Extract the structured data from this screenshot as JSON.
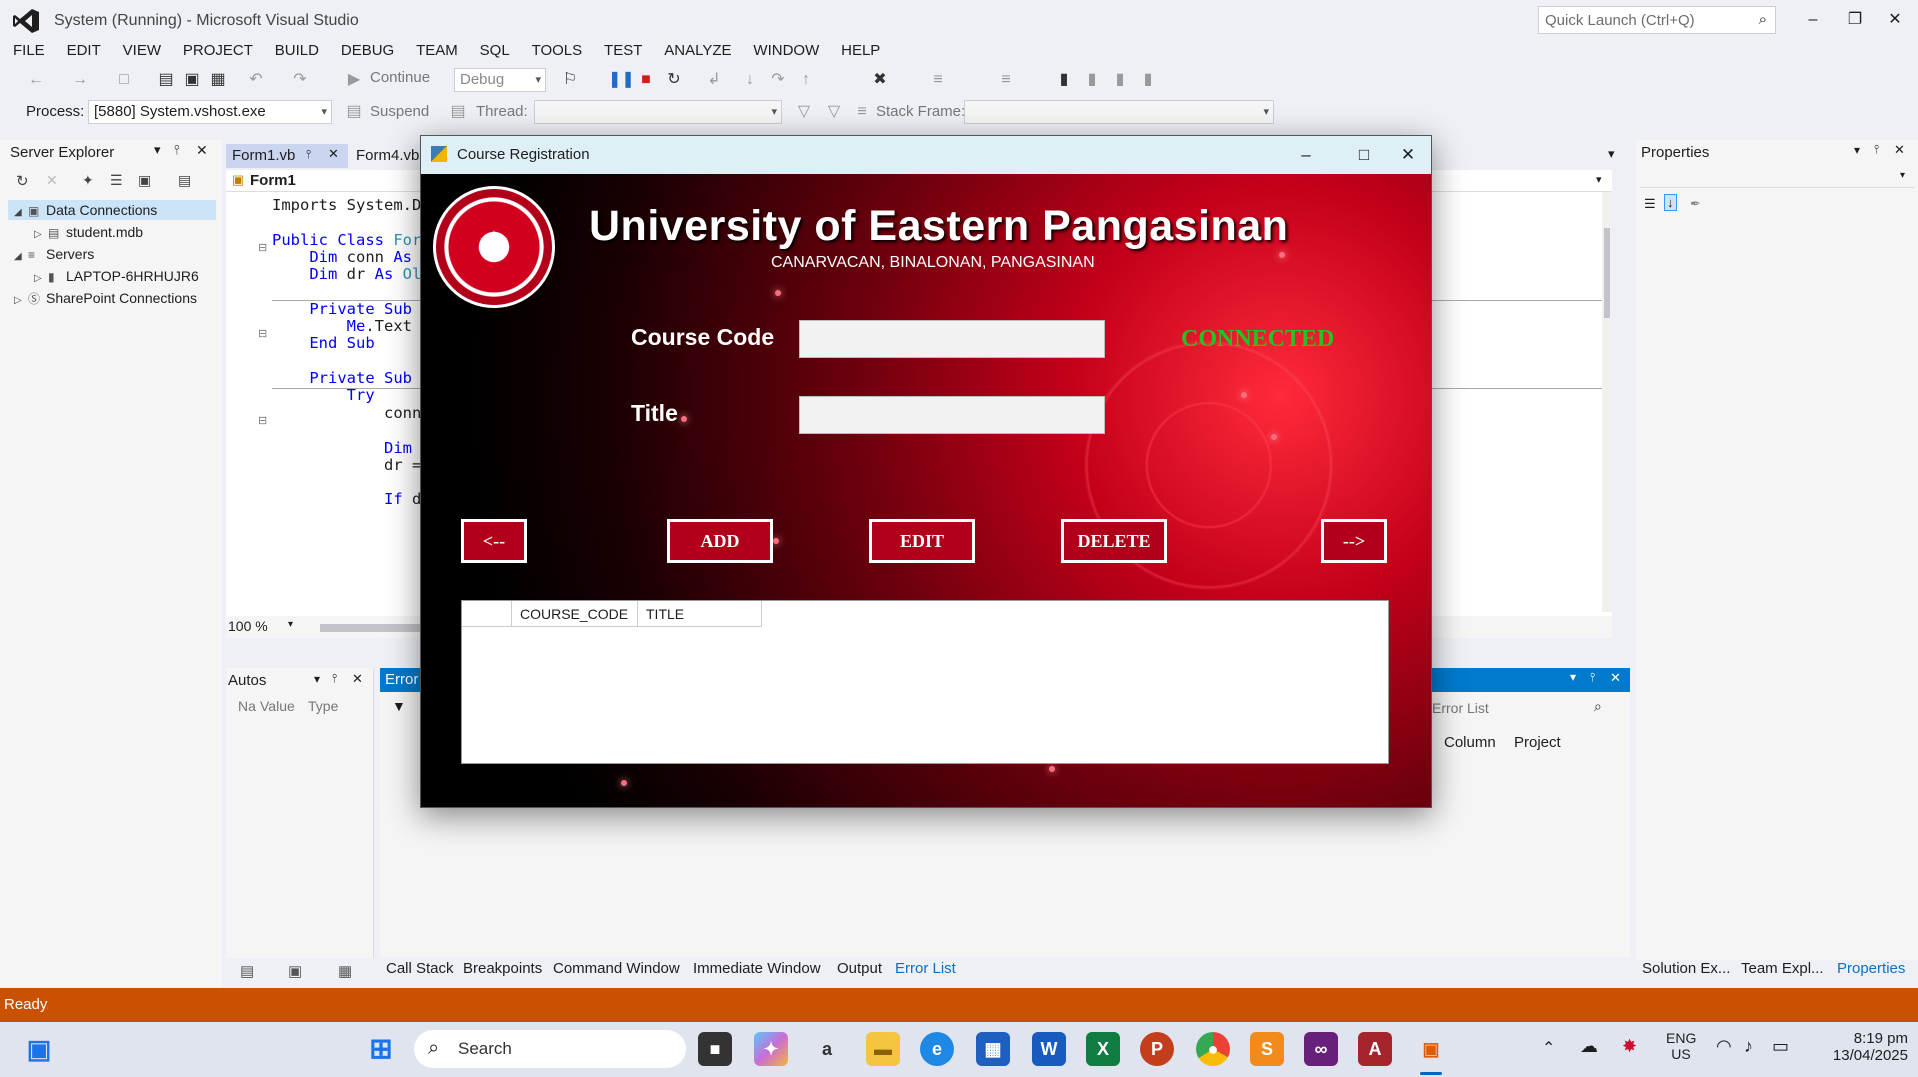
{
  "vs": {
    "title": "System (Running) - Microsoft Visual Studio",
    "quick_launch_placeholder": "Quick Launch (Ctrl+Q)",
    "menu": [
      "FILE",
      "EDIT",
      "VIEW",
      "PROJECT",
      "BUILD",
      "DEBUG",
      "TEAM",
      "SQL",
      "TOOLS",
      "TEST",
      "ANALYZE",
      "WINDOW",
      "HELP"
    ],
    "toolbar": {
      "continue_label": "Continue",
      "config_value": "Debug",
      "process_label": "Process:",
      "process_value": "[5880] System.vshost.exe",
      "suspend_label": "Suspend",
      "thread_label": "Thread:",
      "stack_frame_label": "Stack Frame:"
    },
    "server_explorer": {
      "title": "Server Explorer",
      "items": [
        {
          "label": "Data Connections"
        },
        {
          "label": "student.mdb"
        },
        {
          "label": "Servers"
        },
        {
          "label": "LAPTOP-6HRHUJR6"
        },
        {
          "label": "SharePoint Connections"
        }
      ]
    },
    "editor": {
      "tabs": [
        "Form1.vb",
        "Form4.vb"
      ],
      "class_dropdown": "Form1",
      "zoom": "100 %",
      "code": [
        {
          "indent": "",
          "parts": [
            {
              "t": "Imports System.Da",
              "c": ""
            }
          ]
        },
        {
          "indent": "",
          "parts": [
            {
              "t": "Public Class ",
              "c": "kw"
            },
            {
              "t": "For",
              "c": "ty"
            }
          ]
        },
        {
          "indent": "    ",
          "parts": [
            {
              "t": "Dim ",
              "c": "kw"
            },
            {
              "t": "conn ",
              "c": ""
            },
            {
              "t": "As ",
              "c": "kw"
            }
          ]
        },
        {
          "indent": "    ",
          "parts": [
            {
              "t": "Dim ",
              "c": "kw"
            },
            {
              "t": "dr ",
              "c": ""
            },
            {
              "t": "As ",
              "c": "kw"
            },
            {
              "t": "Ol",
              "c": "ty"
            }
          ]
        },
        {
          "indent": "    ",
          "parts": [
            {
              "t": "Private Sub ",
              "c": "kw"
            }
          ]
        },
        {
          "indent": "        ",
          "parts": [
            {
              "t": "Me",
              "c": "kw"
            },
            {
              "t": ".Text =",
              "c": ""
            }
          ]
        },
        {
          "indent": "    ",
          "parts": [
            {
              "t": "End Sub",
              "c": "kw"
            }
          ]
        },
        {
          "indent": "    ",
          "parts": [
            {
              "t": "Private Sub ",
              "c": "kw"
            }
          ]
        },
        {
          "indent": "        ",
          "parts": [
            {
              "t": "Try",
              "c": "kw"
            }
          ]
        },
        {
          "indent": "            ",
          "parts": [
            {
              "t": "conn",
              "c": ""
            }
          ]
        },
        {
          "indent": "            ",
          "parts": [
            {
              "t": "Dim ",
              "c": "kw"
            }
          ]
        },
        {
          "indent": "            ",
          "parts": [
            {
              "t": "dr =",
              "c": ""
            }
          ]
        },
        {
          "indent": "            ",
          "parts": [
            {
              "t": "If ",
              "c": "kw"
            },
            {
              "t": "d",
              "c": ""
            }
          ]
        }
      ]
    },
    "autos": {
      "title": "Autos",
      "col_name": "Na",
      "col_value": "Value",
      "col_type": "Type"
    },
    "error_list": {
      "tab_label": "Error",
      "search_placeholder": "Error List",
      "col_column": "Column",
      "col_project": "Project"
    },
    "properties": {
      "title": "Properties"
    },
    "bottom_tabs": [
      "Call Stack",
      "Breakpoints",
      "Command Window",
      "Immediate Window",
      "Output",
      "Error List"
    ],
    "right_tabs": [
      "Solution Ex...",
      "Team Expl...",
      "Properties"
    ],
    "status": "Ready",
    "colors": {
      "status_bar": "#ca5100",
      "accent": "#007acc"
    }
  },
  "app": {
    "window_title": "Course Registration",
    "university_name": "University of Eastern Pangasinan",
    "address": "CANARVACAN, BINALONAN, PANGASINAN",
    "fields": {
      "course_code_label": "Course Code",
      "course_code_value": "",
      "title_label": "Title",
      "title_value": ""
    },
    "connection_status": "CONNECTED",
    "buttons": {
      "prev": "<--",
      "add": "ADD",
      "edit": "EDIT",
      "delete": "DELETE",
      "next": "-->"
    },
    "grid": {
      "columns": [
        "",
        "COURSE_CODE",
        "TITLE"
      ],
      "rows": []
    },
    "colors": {
      "button_bg": "#b3001a",
      "connected": "#22c422",
      "header_red": "#d1001f"
    }
  },
  "taskbar": {
    "search_placeholder": "Search",
    "lang_line1": "ENG",
    "lang_line2": "US",
    "time": "8:19 pm",
    "date": "13/04/2025"
  }
}
